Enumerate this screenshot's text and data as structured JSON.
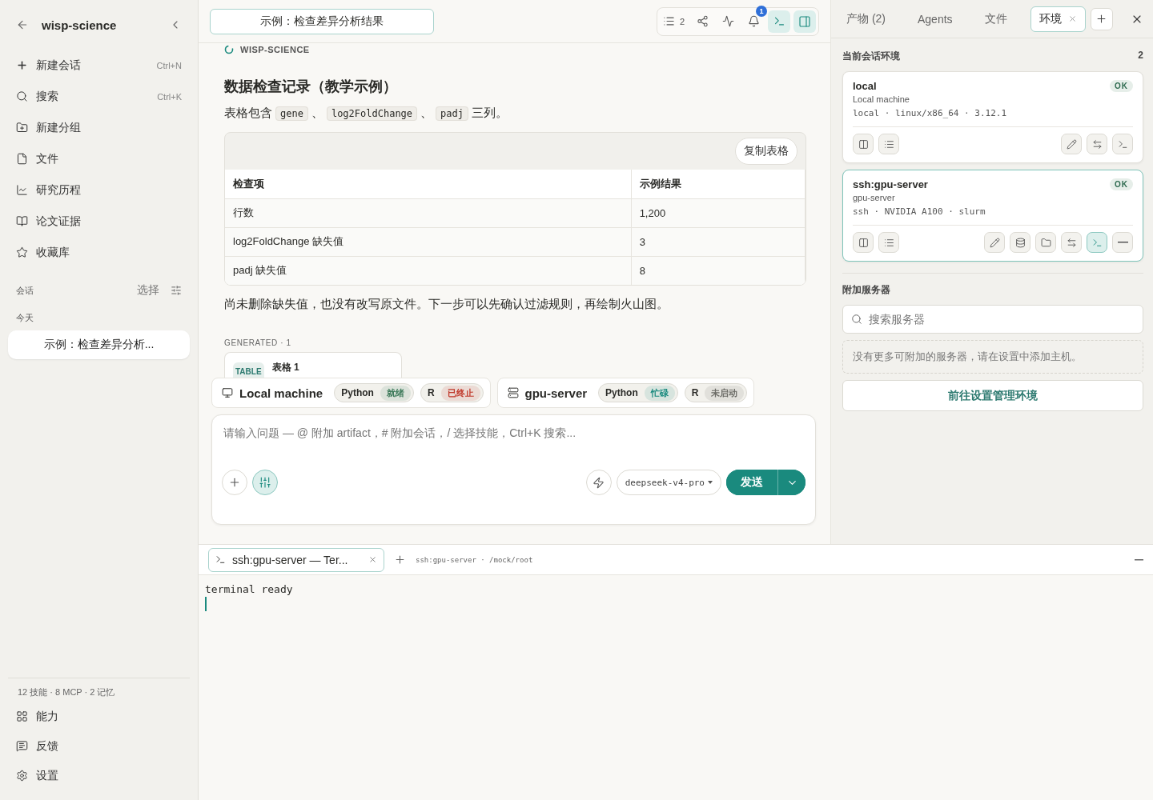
{
  "sidebar": {
    "title": "wisp-science",
    "nav": [
      {
        "label": "新建会话",
        "shortcut": "Ctrl+N"
      },
      {
        "label": "搜索",
        "shortcut": "Ctrl+K"
      },
      {
        "label": "新建分组"
      },
      {
        "label": "文件"
      },
      {
        "label": "研究历程"
      },
      {
        "label": "论文证据"
      },
      {
        "label": "收藏库"
      }
    ],
    "sessions_label": "会话",
    "select_label": "选择",
    "group_label": "今天",
    "sessions": [
      {
        "title": "示例：检查差异分析...",
        "selected": true
      }
    ],
    "stats": "12 技能 · 8 MCP · 2 记忆",
    "footer": [
      {
        "label": "能力"
      },
      {
        "label": "反馈"
      },
      {
        "label": "设置"
      }
    ]
  },
  "main": {
    "title": "示例：检查差异分析结果",
    "toolbar": {
      "outline_count": "2",
      "notifications": "1",
      "terminal_on": true,
      "panel_on": true
    },
    "brand": "WISP-SCIENCE",
    "heading": "数据检查记录（教学示例）",
    "intro": [
      {
        "kind": "text",
        "text": "表格包含"
      },
      {
        "kind": "code",
        "text": "gene"
      },
      {
        "kind": "text",
        "text": "、"
      },
      {
        "kind": "code",
        "text": "log2FoldChange"
      },
      {
        "kind": "text",
        "text": "、"
      },
      {
        "kind": "code",
        "text": "padj"
      },
      {
        "kind": "text",
        "text": "三列。"
      }
    ],
    "table": {
      "copy_label": "复制表格",
      "columns": [
        "检查项",
        "示例结果"
      ],
      "rows": [
        [
          "行数",
          "1,200"
        ],
        [
          "log2FoldChange 缺失值",
          "3"
        ],
        [
          "padj 缺失值",
          "8"
        ]
      ]
    },
    "conclusion": "尚未删除缺失值，也没有改写原文件。下一步可以先确认过滤规则，再绘制火山图。",
    "generated_label": "GENERATED · 1",
    "artifact": {
      "badge": "TABLE",
      "title": "表格 1"
    },
    "environments": [
      {
        "name": "Local machine",
        "runtimes": [
          {
            "lang": "Python",
            "status": "就绪",
            "color": "#3d7a5a"
          },
          {
            "lang": "R",
            "status": "已终止",
            "color": "#c0392b"
          }
        ]
      },
      {
        "name": "gpu-server",
        "runtimes": [
          {
            "lang": "Python",
            "status": "忙碌",
            "color": "#1a8a7e"
          },
          {
            "lang": "R",
            "status": "未启动",
            "color": "#6b6b66"
          }
        ]
      }
    ],
    "composer": {
      "placeholder": "请输入问题 — @ 附加 artifact，# 附加会话，/ 选择技能，Ctrl+K 搜索...",
      "tools_on": true,
      "model": "deepseek-v4-pro",
      "send": "发送"
    }
  },
  "panel": {
    "tabs": [
      {
        "label": "产物 (2)",
        "selected": false
      },
      {
        "label": "Agents",
        "selected": false
      },
      {
        "label": "文件",
        "selected": false
      },
      {
        "label": "环境",
        "selected": true
      }
    ],
    "current_label": "当前会话环境",
    "current_count": "2",
    "envs": [
      {
        "name": "local",
        "status": "OK",
        "subtitle": "Local machine",
        "meta": "local · linux/x86_64 · 3.12.1",
        "selected": false,
        "actions": [
          {
            "kind": "edit",
            "on": false
          },
          {
            "kind": "transfer",
            "on": false
          },
          {
            "kind": "terminal",
            "on": false
          }
        ]
      },
      {
        "name": "ssh:gpu-server",
        "status": "OK",
        "subtitle": "gpu-server",
        "meta": "ssh · NVIDIA A100 · slurm",
        "selected": true,
        "actions": [
          {
            "kind": "edit",
            "on": false
          },
          {
            "kind": "database",
            "on": false
          },
          {
            "kind": "folder",
            "on": false
          },
          {
            "kind": "transfer",
            "on": false
          },
          {
            "kind": "terminal",
            "on": true
          },
          {
            "kind": "detach",
            "on": false
          }
        ]
      }
    ],
    "attach_label": "附加服务器",
    "search_placeholder": "搜索服务器",
    "empty_note": "没有更多可附加的服务器，请在设置中添加主机。",
    "manage_label": "前往设置管理环境"
  },
  "terminal": {
    "tab": "ssh:gpu-server — Ter...",
    "path": "ssh:gpu-server · /mock/root",
    "lines": [
      "terminal ready"
    ]
  }
}
